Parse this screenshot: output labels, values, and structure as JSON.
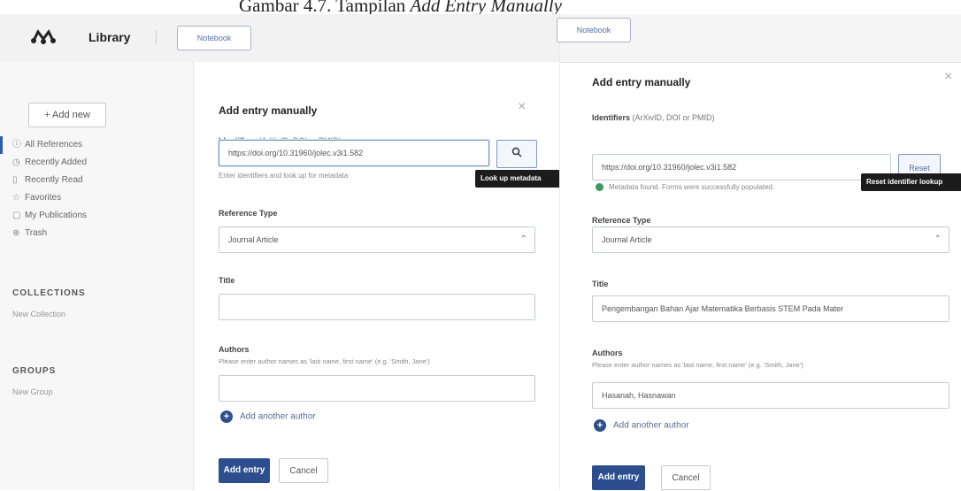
{
  "caption": {
    "prefix": "Gambar 4.7. Tampilan ",
    "italic": "Add Entry Manually"
  },
  "left": {
    "app_title": "Library",
    "notebook_button": "Notebook",
    "add_new": "+ Add new",
    "nav": [
      {
        "label": "All References",
        "icon": "ⓘ",
        "active": true
      },
      {
        "label": "Recently Added",
        "icon": "◷",
        "active": false
      },
      {
        "label": "Recently Read",
        "icon": "▯",
        "active": false
      },
      {
        "label": "Favorites",
        "icon": "☆",
        "active": false
      },
      {
        "label": "My Publications",
        "icon": "▢",
        "active": false
      },
      {
        "label": "Trash",
        "icon": "⊕",
        "active": false
      }
    ],
    "collections_title": "COLLECTIONS",
    "new_collection": "New Collection",
    "groups_title": "GROUPS",
    "new_group": "New Group",
    "modal": {
      "title": "Add entry manually",
      "close": "×",
      "identifiers_label": "Identifiers",
      "identifiers_sub": "(ArXivID, DOI or PMID)",
      "identifier_value": "https://doi.org/10.31960/jolec.v3i1.582",
      "identifier_hint": "Enter identifiers and look up for metadata",
      "lookup_icon": "🔍",
      "lookup_tooltip": "Look up metadata",
      "reference_type_label": "Reference Type",
      "reference_type_value": "Journal Article",
      "title_label": "Title",
      "title_value": "",
      "authors_label": "Authors",
      "authors_hint": "Please enter author names as 'last name, first name' (e.g. 'Smith, Jane')",
      "author_value": "",
      "add_author": "Add another author",
      "add_entry": "Add entry",
      "cancel": "Cancel"
    }
  },
  "right": {
    "notebook_button": "Notebook",
    "modal": {
      "title": "Add entry manually",
      "close": "×",
      "identifiers_label": "Identifiers",
      "identifiers_sub": "(ArXivID, DOI or PMID)",
      "identifier_value": "https://doi.org/10.31960/jolec.v3i1.582",
      "reset": "Reset",
      "reset_tooltip": "Reset identifier lookup",
      "success_msg": "Metadata found. Forms were successfully populated.",
      "reference_type_label": "Reference Type",
      "reference_type_value": "Journal Article",
      "title_label": "Title",
      "title_value": "Pengembangan Bahan Ajar Matematika Berbasis STEM Pada Mater",
      "authors_label": "Authors",
      "authors_hint": "Please enter author names as 'last name, first name' (e.g. 'Smith, Jane')",
      "author_value": "Hasanah, Hasnawan",
      "add_author": "Add another author",
      "add_entry": "Add entry",
      "cancel": "Cancel"
    }
  }
}
